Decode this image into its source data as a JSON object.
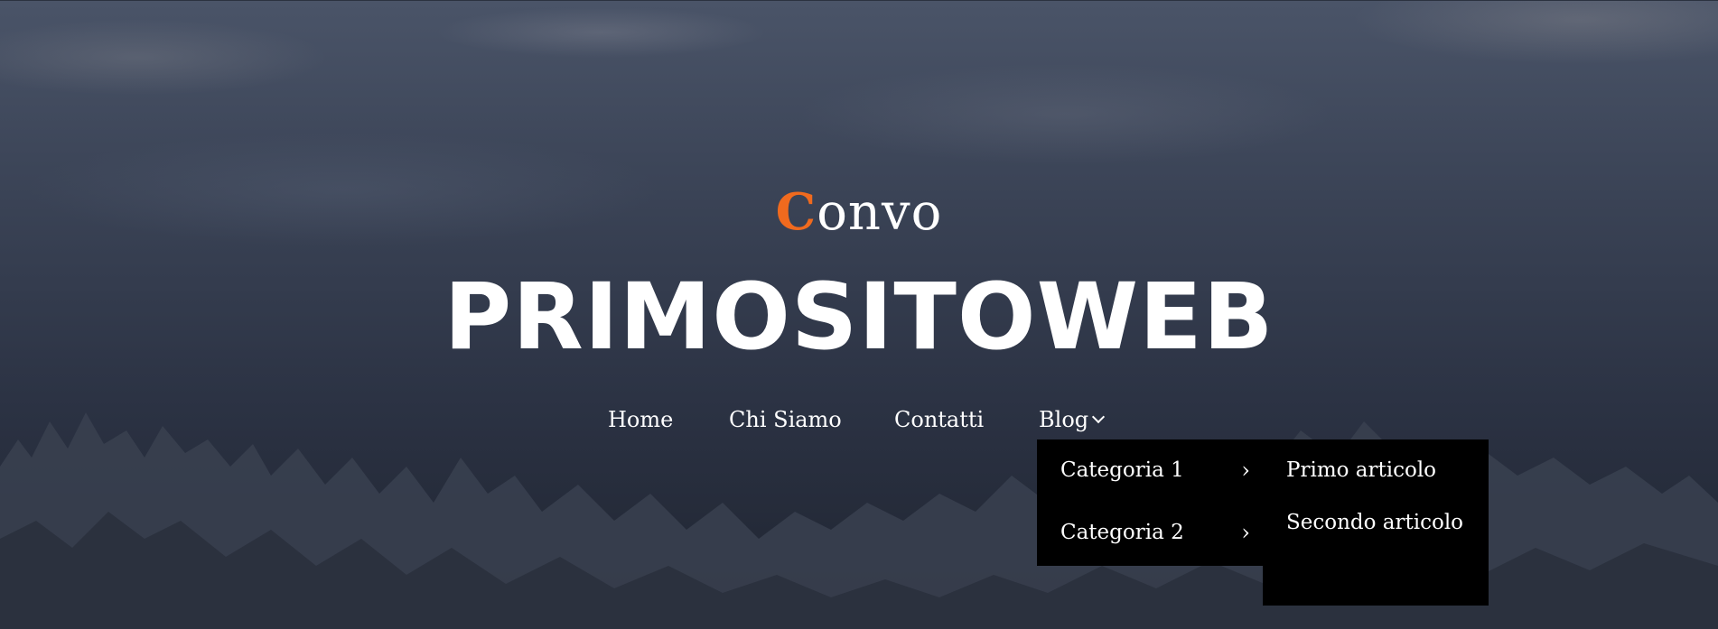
{
  "header": {
    "logo_text": "onvo",
    "logo_accent": "C",
    "site_title": "PRIMOSITOWEB"
  },
  "nav": {
    "items": [
      {
        "label": "Home"
      },
      {
        "label": "Chi Siamo"
      },
      {
        "label": "Contatti"
      },
      {
        "label": "Blog"
      }
    ]
  },
  "dropdown": {
    "items": [
      {
        "label": "Categoria 1",
        "arrow": "›"
      },
      {
        "label": "Categoria 2",
        "arrow": "›"
      }
    ]
  },
  "submenu": {
    "items": [
      {
        "label": "Primo articolo"
      },
      {
        "label": "Secondo articolo"
      }
    ]
  },
  "colors": {
    "accent": "#f06a1e",
    "menu_bg": "#000000",
    "text": "#ffffff"
  }
}
